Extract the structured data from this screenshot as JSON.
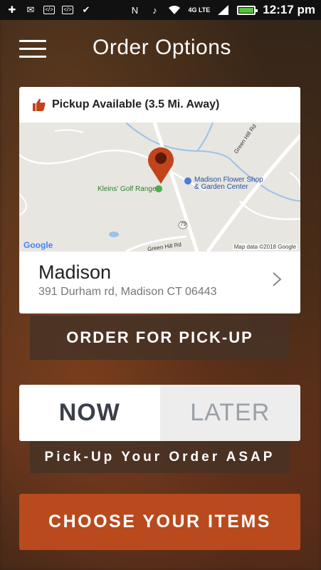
{
  "status_bar": {
    "time": "12:17 pm",
    "network": "4G LTE"
  },
  "header": {
    "title": "Order Options"
  },
  "location_card": {
    "pickup_text": "Pickup Available (3.5 Mi. Away)",
    "map": {
      "labels": {
        "golf": "Kleins' Golf Range",
        "flower_line1": "Madison Flower Shop",
        "flower_line2": "& Garden Center",
        "road_north": "Green Hill Rd",
        "road_south": "Green Hill Rd",
        "route": "79"
      },
      "google": "Google",
      "attribution": "Map data ©2018 Google"
    },
    "name": "Madison",
    "address": "391 Durham rd, Madison CT 06443"
  },
  "order_pickup_label": "ORDER FOR PICK-UP",
  "timing": {
    "now": "NOW",
    "later": "LATER",
    "selected": "NOW",
    "note": "Pick-Up Your Order ASAP"
  },
  "choose_items_label": "CHOOSE YOUR ITEMS",
  "colors": {
    "accent": "#b84a1d",
    "pin": "#c1441c",
    "battery": "#57c23b"
  }
}
